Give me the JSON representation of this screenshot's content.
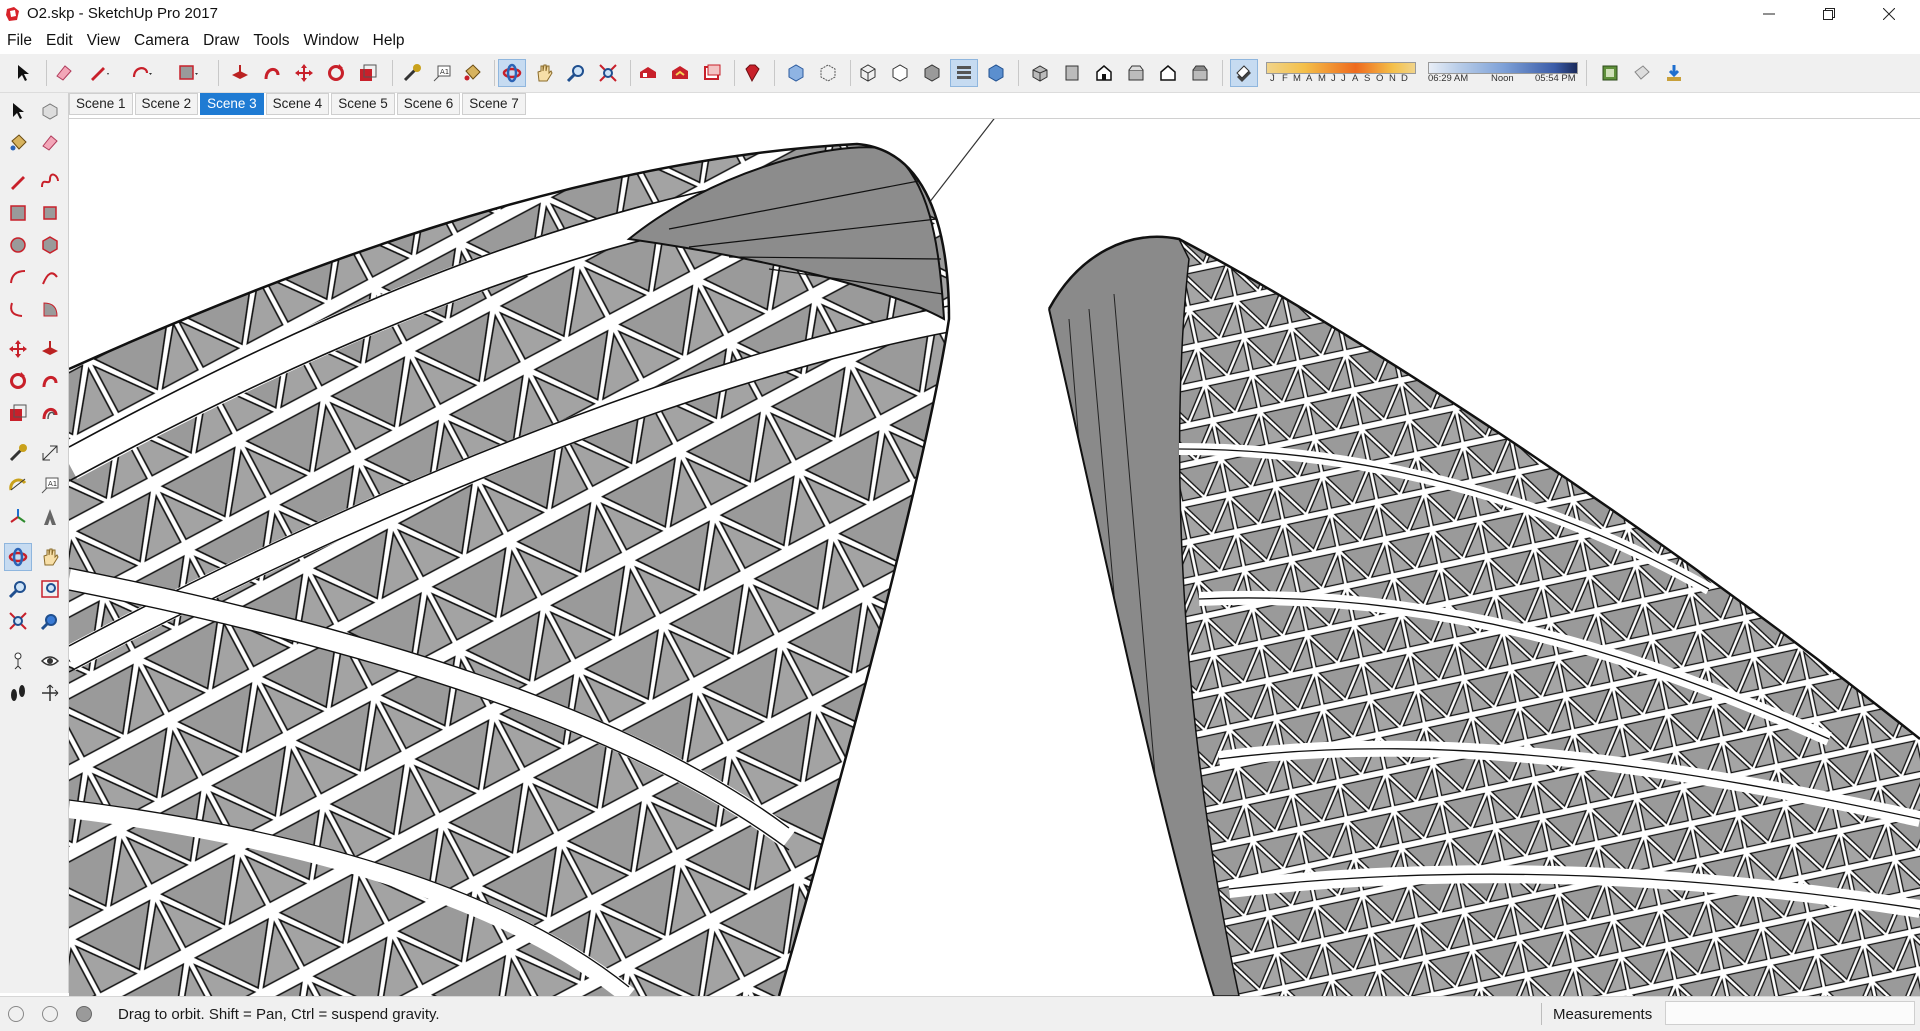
{
  "window": {
    "title": "O2.skp - SketchUp Pro 2017",
    "controls": [
      "minimize",
      "restore",
      "close"
    ]
  },
  "menu": [
    "File",
    "Edit",
    "View",
    "Camera",
    "Draw",
    "Tools",
    "Window",
    "Help"
  ],
  "toolbar": {
    "shadow_months": [
      "J",
      "F",
      "M",
      "A",
      "M",
      "J",
      "J",
      "A",
      "S",
      "O",
      "N",
      "D"
    ],
    "shadow_times": {
      "start": "06:29 AM",
      "noon": "Noon",
      "end": "05:54 PM"
    },
    "icons": [
      "select-icon",
      "eraser-icon",
      "pencil-icon",
      "freehand-icon",
      "rectangle-icon",
      "pushpull-icon",
      "followme-icon",
      "move-icon",
      "rotate-icon",
      "scale-icon",
      "tape-measure-icon",
      "text-icon",
      "paint-bucket-icon",
      "orbit-icon",
      "pan-icon",
      "zoom-icon",
      "zoom-extents-icon",
      "warehouse-icon",
      "extension-warehouse-icon",
      "layout-icon",
      "ruby-icon",
      "xray-icon",
      "backedges-icon",
      "wireframe-icon",
      "hidden-line-icon",
      "shaded-icon",
      "shaded-textures-icon",
      "monochrome-icon",
      "iso-view-icon",
      "top-view-icon",
      "front-view-icon",
      "right-view-icon",
      "back-view-icon",
      "left-view-icon",
      "shadows-toggle-icon",
      "section-plane-icon",
      "section-display-icon",
      "import-icon"
    ]
  },
  "palette_icons": [
    "select-icon",
    "component-icon",
    "paint-bucket-icon",
    "eraser-icon",
    "line-icon",
    "freehand-icon",
    "rectangle-icon",
    "rotated-rectangle-icon",
    "circle-icon",
    "polygon-icon",
    "arc-icon",
    "two-point-arc-icon",
    "three-point-arc-icon",
    "pie-icon",
    "move-icon",
    "pushpull-icon",
    "rotate-icon",
    "followme-icon",
    "scale-icon",
    "offset-icon",
    "tape-measure-icon",
    "dimension-icon",
    "protractor-icon",
    "text-icon",
    "axes-icon",
    "3d-text-icon",
    "orbit-icon",
    "pan-icon",
    "zoom-icon",
    "zoom-window-icon",
    "zoom-extents-icon",
    "previous-view-icon",
    "position-camera-icon",
    "look-around-icon",
    "walk-icon",
    "section-plane-icon"
  ],
  "scenes": {
    "tabs": [
      "Scene 1",
      "Scene 2",
      "Scene 3",
      "Scene 4",
      "Scene 5",
      "Scene 6",
      "Scene 7"
    ],
    "active": "Scene 3"
  },
  "status": {
    "message": "Drag to orbit. Shift = Pan, Ctrl = suspend gravity.",
    "measurements_label": "Measurements",
    "measurements_value": ""
  },
  "colors": {
    "accent": "#1f7bd3",
    "tower_fill": "#9a9a9a",
    "tower_edge": "#111111"
  }
}
